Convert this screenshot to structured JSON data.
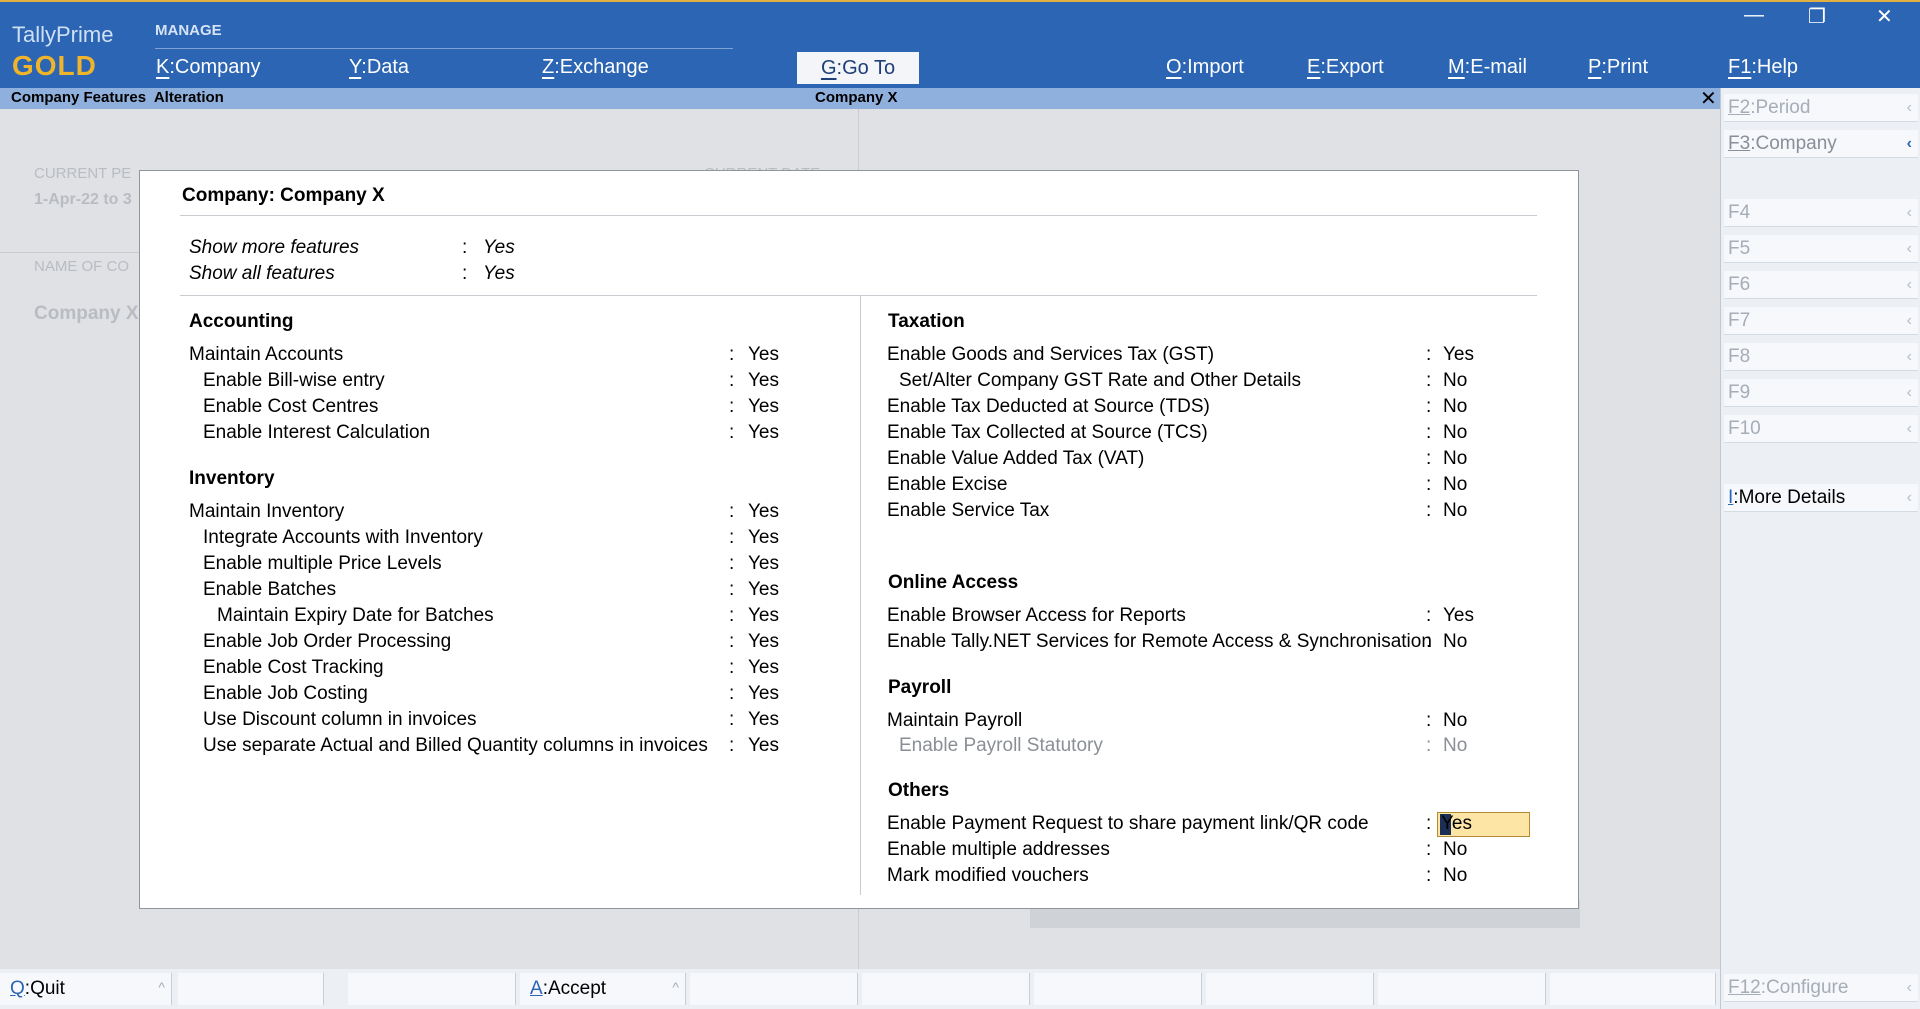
{
  "app": {
    "name": "TallyPrime",
    "edition": "GOLD"
  },
  "header": {
    "manage_label": "MANAGE",
    "menu": {
      "company": {
        "key": "K",
        "label": "Company"
      },
      "data": {
        "key": "Y",
        "label": "Data"
      },
      "exchange": {
        "key": "Z",
        "label": "Exchange"
      },
      "goto": {
        "key": "G",
        "label": "Go To"
      },
      "import": {
        "key": "O",
        "label": "Import"
      },
      "export": {
        "key": "E",
        "label": "Export"
      },
      "email": {
        "key": "M",
        "label": "E-mail"
      },
      "print": {
        "key": "P",
        "label": "Print"
      },
      "help": {
        "key": "F1",
        "label": "Help"
      }
    },
    "window": {
      "minimize": "—",
      "restore": "❐",
      "close": "✕"
    }
  },
  "screen": {
    "title_left": "Company Features  Alteration",
    "title_center": "Company X",
    "close": "✕"
  },
  "background": {
    "current_period_label": "CURRENT PE",
    "current_period_value": "1-Apr-22 to 3",
    "current_date_label": "CURRENT DATE",
    "company_name_label": "NAME OF CO",
    "company_name_value": "Company X"
  },
  "dialog": {
    "title": "Company: Company X",
    "top": [
      {
        "label": "Show more features",
        "value": "Yes"
      },
      {
        "label": "Show all features",
        "value": "Yes"
      }
    ],
    "accounting": {
      "heading": "Accounting",
      "rows": [
        {
          "label": "Maintain Accounts",
          "value": "Yes"
        },
        {
          "label": "Enable Bill-wise entry",
          "value": "Yes"
        },
        {
          "label": "Enable Cost Centres",
          "value": "Yes"
        },
        {
          "label": "Enable Interest Calculation",
          "value": "Yes"
        }
      ]
    },
    "inventory": {
      "heading": "Inventory",
      "rows": [
        {
          "label": "Maintain Inventory",
          "value": "Yes"
        },
        {
          "label": "Integrate Accounts with Inventory",
          "value": "Yes"
        },
        {
          "label": "Enable multiple Price Levels",
          "value": "Yes"
        },
        {
          "label": "Enable Batches",
          "value": "Yes"
        },
        {
          "label": "Maintain Expiry Date for Batches",
          "value": "Yes"
        },
        {
          "label": "Enable Job Order Processing",
          "value": "Yes"
        },
        {
          "label": "Enable Cost Tracking",
          "value": "Yes"
        },
        {
          "label": "Enable Job Costing",
          "value": "Yes"
        },
        {
          "label": "Use Discount column in invoices",
          "value": "Yes"
        },
        {
          "label": "Use separate Actual and Billed Quantity columns in invoices",
          "value": "Yes"
        }
      ]
    },
    "taxation": {
      "heading": "Taxation",
      "rows": [
        {
          "label": "Enable Goods and Services Tax (GST)",
          "value": "Yes"
        },
        {
          "label": "Set/Alter Company GST Rate and Other Details",
          "value": "No"
        },
        {
          "label": "Enable Tax Deducted at Source (TDS)",
          "value": "No"
        },
        {
          "label": "Enable Tax Collected at Source (TCS)",
          "value": "No"
        },
        {
          "label": "Enable Value Added Tax (VAT)",
          "value": "No"
        },
        {
          "label": "Enable Excise",
          "value": "No"
        },
        {
          "label": "Enable Service Tax",
          "value": "No"
        }
      ]
    },
    "online_access": {
      "heading": "Online Access",
      "rows": [
        {
          "label": "Enable Browser Access for Reports",
          "value": "Yes"
        },
        {
          "label": "Enable Tally.NET Services for Remote Access & Synchronisation",
          "value": "No"
        }
      ]
    },
    "payroll": {
      "heading": "Payroll",
      "rows": [
        {
          "label": "Maintain Payroll",
          "value": "No"
        },
        {
          "label": "Enable Payroll Statutory",
          "value": "No"
        }
      ]
    },
    "others": {
      "heading": "Others",
      "rows": [
        {
          "label": "Enable Payment Request to share payment link/QR code",
          "value": "Yes"
        },
        {
          "label": "Enable multiple addresses",
          "value": "No"
        },
        {
          "label": "Mark modified vouchers",
          "value": "No"
        }
      ]
    },
    "colon": ":"
  },
  "side_panel": {
    "period": {
      "key": "F2",
      "label": "Period"
    },
    "company": {
      "key": "F3",
      "label": "Company"
    },
    "f4": "F4",
    "f5": "F5",
    "f6": "F6",
    "f7": "F7",
    "f8": "F8",
    "f9": "F9",
    "f10": "F10",
    "more_details": {
      "key": "I",
      "label": "More Details"
    },
    "configure": {
      "key": "F12",
      "label": "Configure"
    }
  },
  "bottom_bar": {
    "quit": {
      "key": "Q",
      "label": "Quit"
    },
    "accept": {
      "key": "A",
      "label": "Accept"
    }
  },
  "colors": {
    "header_blue": "#2b65b3",
    "title_strip": "#8fb0dc",
    "gold": "#f0b42a",
    "focus_field": "#fde5a6"
  }
}
